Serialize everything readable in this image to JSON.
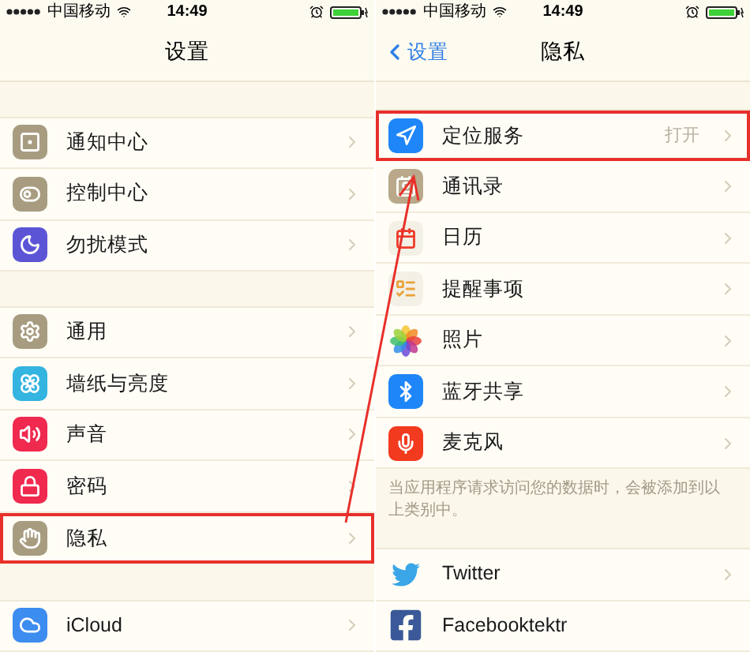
{
  "left": {
    "status_bar": {
      "carrier": "中国移动",
      "time": "14:49"
    },
    "title": "设置",
    "groups": [
      {
        "rows": [
          {
            "label": "通知中心",
            "highlighted": false,
            "chevron": true
          },
          {
            "label": "控制中心",
            "highlighted": false,
            "chevron": true
          },
          {
            "label": "勿扰模式",
            "highlighted": false,
            "chevron": true
          }
        ]
      },
      {
        "rows": [
          {
            "label": "通用",
            "highlighted": false,
            "chevron": true
          },
          {
            "label": "墙纸与亮度",
            "highlighted": false,
            "chevron": true
          },
          {
            "label": "声音",
            "highlighted": false,
            "chevron": true
          },
          {
            "label": "密码",
            "highlighted": false,
            "chevron": true
          },
          {
            "label": "隐私",
            "highlighted": true,
            "chevron": true
          }
        ]
      },
      {
        "rows": [
          {
            "label": "iCloud",
            "highlighted": false,
            "chevron": true
          }
        ]
      }
    ]
  },
  "right": {
    "status_bar": {
      "carrier": "中国移动",
      "time": "14:49"
    },
    "back": "设置",
    "title": "隐私",
    "groups": [
      {
        "rows": [
          {
            "label": "定位服务",
            "value": "打开",
            "highlighted": true,
            "chevron": true
          },
          {
            "label": "通讯录",
            "highlighted": false,
            "chevron": true
          },
          {
            "label": "日历",
            "highlighted": false,
            "chevron": true
          },
          {
            "label": "提醒事项",
            "highlighted": false,
            "chevron": true
          },
          {
            "label": "照片",
            "highlighted": false,
            "chevron": true
          },
          {
            "label": "蓝牙共享",
            "highlighted": false,
            "chevron": true
          },
          {
            "label": "麦克风",
            "highlighted": false,
            "chevron": true
          }
        ],
        "footer": "当应用程序请求访问您的数据时，会被添加到以上类别中。"
      },
      {
        "rows": [
          {
            "label": "Twitter",
            "highlighted": false,
            "chevron": true
          },
          {
            "label": "Facebooktektr",
            "highlighted": false,
            "chevron": false
          }
        ]
      }
    ]
  },
  "annotation_arrow": true
}
